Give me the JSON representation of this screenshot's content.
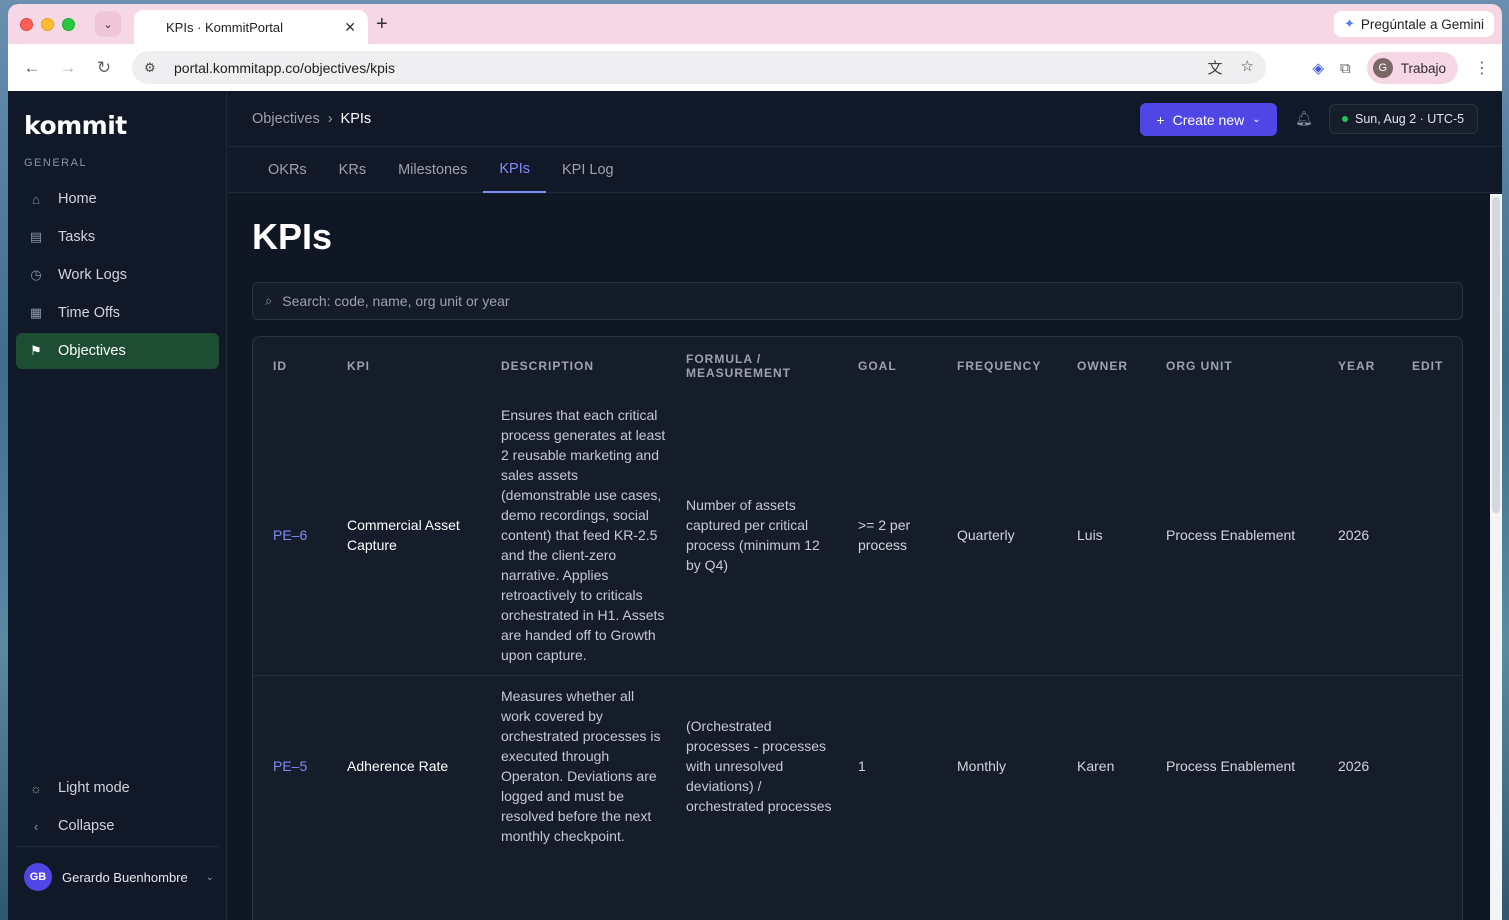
{
  "browser": {
    "tab_title": "KPIs · KommitPortal",
    "tab_close": "✕",
    "new_tab": "+",
    "gemini_label": "Pregúntale a Gemini",
    "url": "portal.kommitapp.co/objectives/kpis",
    "profile_initial": "G",
    "profile_name": "Trabajo"
  },
  "sidebar": {
    "logo": "kommit",
    "section_label": "GENERAL",
    "items": [
      {
        "label": "Home",
        "icon": "home-icon"
      },
      {
        "label": "Tasks",
        "icon": "clipboard-icon"
      },
      {
        "label": "Work Logs",
        "icon": "clock-icon"
      },
      {
        "label": "Time Offs",
        "icon": "calendar-icon"
      },
      {
        "label": "Objectives",
        "icon": "flag-icon",
        "active": true
      }
    ],
    "light_mode": "Light mode",
    "collapse": "Collapse",
    "user_initials": "GB",
    "user_name": "Gerardo Buenhombre"
  },
  "header": {
    "breadcrumb_parent": "Objectives",
    "breadcrumb_sep": "›",
    "breadcrumb_current": "KPIs",
    "create_new": "Create new",
    "date": "Sun, Aug 2 · UTC-5"
  },
  "subtabs": [
    "OKRs",
    "KRs",
    "Milestones",
    "KPIs",
    "KPI Log"
  ],
  "page": {
    "title": "KPIs",
    "search_placeholder": "Search: code, name, org unit or year"
  },
  "table": {
    "columns": [
      "ID",
      "KPI",
      "DESCRIPTION",
      "FORMULA / MEASUREMENT",
      "GOAL",
      "FREQUENCY",
      "OWNER",
      "ORG UNIT",
      "YEAR",
      "EDIT"
    ],
    "rows": [
      {
        "id": "PE–6",
        "kpi": "Commercial Asset Capture",
        "description": "Ensures that each critical process generates at least 2 reusable marketing and sales assets (demonstrable use cases, demo recordings, social content) that feed KR-2.5 and the client-zero narrative. Applies retroactively to criticals orchestrated in H1. Assets are handed off to Growth upon capture.",
        "formula": "Number of assets captured per critical process (minimum 12 by Q4)",
        "goal": ">= 2 per process",
        "frequency": "Quarterly",
        "owner": "Luis",
        "org_unit": "Process Enablement",
        "year": "2026"
      },
      {
        "id": "PE–5",
        "kpi": "Adherence Rate",
        "description": "Measures whether all work covered by orchestrated processes is executed through Operaton. Deviations are logged and must be resolved before the next monthly checkpoint.",
        "formula": "(Orchestrated processes - processes with unresolved deviations) / orchestrated processes",
        "goal": "1",
        "frequency": "Monthly",
        "owner": "Karen",
        "org_unit": "Process Enablement",
        "year": "2026"
      }
    ]
  },
  "colors": {
    "accent": "#4f46e5",
    "link": "#818cf8",
    "active_nav": "#1d4d32",
    "background": "#0f1624"
  }
}
